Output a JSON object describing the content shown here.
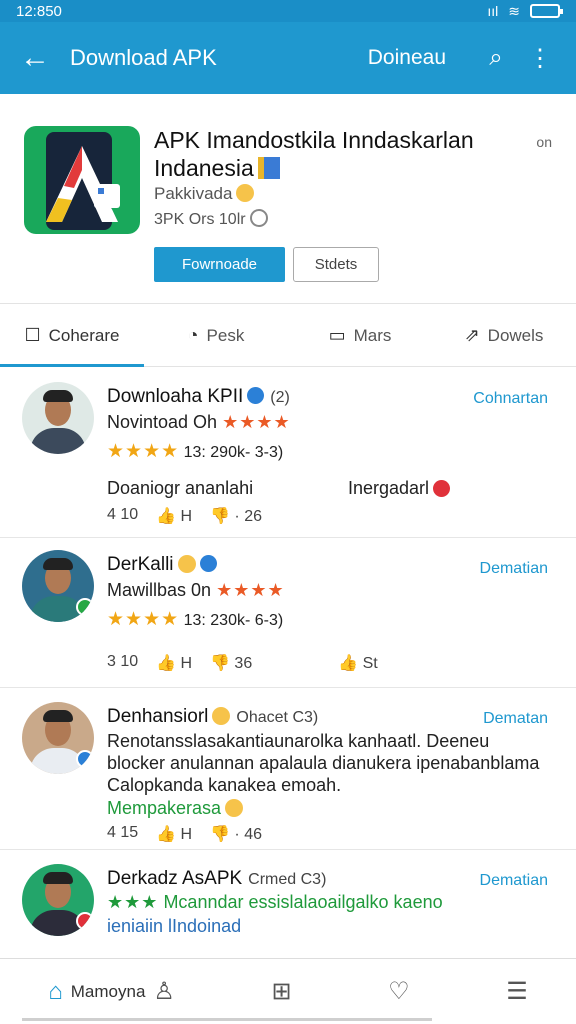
{
  "status_bar": {
    "time": "12:850",
    "signal": "ııl",
    "wifi": "≋"
  },
  "app_bar": {
    "title": "Download APK",
    "action": "Doineau"
  },
  "app": {
    "name": "APK Imandostkila Inndaskarlan Indanesia",
    "publisher": "Pakkivada",
    "meta": "3PK Ors 10lr",
    "primary_button": "Fowrnoade",
    "secondary_button": "Stdets",
    "more": "on"
  },
  "tabs": [
    {
      "label": "Coherare",
      "icon": "edit-icon"
    },
    {
      "label": "Pesk",
      "icon": "compass-icon"
    },
    {
      "label": "Mars",
      "icon": "chat-icon"
    },
    {
      "label": "Dowels",
      "icon": "share-icon"
    }
  ],
  "reviews": [
    {
      "name": "Downloaha KPII",
      "name_suffix": "(2)",
      "action": "Cohnartan",
      "line1": "Novintoad Oh",
      "line1_stars": "★★★★",
      "rating_stars": "★★★★",
      "rating_meta": "13: 290k- 3-3)",
      "text_left": "Doaniogr ananlahi",
      "text_right": "Inergadarl",
      "stats": [
        "4 10",
        "👍 H",
        "👎 · 26"
      ]
    },
    {
      "name": "DerKalli",
      "action": "Dematian",
      "line1": "Mawillbas 0n",
      "line1_stars": "★★★★",
      "rating_stars": "★★★★",
      "rating_meta": "13: 230k- 6-3)",
      "stats": [
        "3 10",
        "👍 H",
        "👎 36",
        "👍 St"
      ]
    },
    {
      "name": "Denhansiorl",
      "name_suffix": "Ohacet C3)",
      "action": "Dematan",
      "text": "Renotansslasakantiaunarolka kanhaatl. Deeneu blocker anulannan apalaula dianukera ipenabanblama Calopkanda kanakea emoah.",
      "green_text": "Mempakerasa",
      "stats": [
        "4 15",
        "👍 H",
        "👎 · 46"
      ]
    },
    {
      "name": "Derkadz AsAPK",
      "name_suffix": "Crmed C3)",
      "action": "Dematian",
      "green_stars": "★★★",
      "green_text": "Mcanndar essislalaoailgalko kaeno",
      "text": "ieniaiin lIndoinad"
    }
  ],
  "bottom_nav": [
    {
      "label": "Mamoyna",
      "icon": "home-icon"
    },
    {
      "label": "",
      "icon": "add-icon"
    },
    {
      "label": "",
      "icon": "chat-icon"
    },
    {
      "label": "",
      "icon": "menu-icon"
    }
  ],
  "colors": {
    "accent": "#1f98cf",
    "star": "#f1a615",
    "green": "#1f9a3b"
  }
}
